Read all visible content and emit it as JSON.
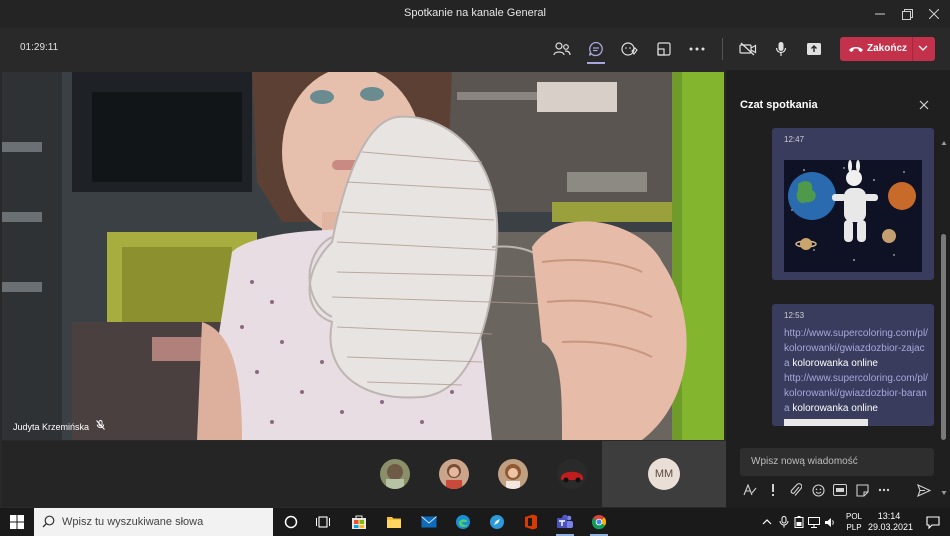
{
  "window": {
    "title": "Spotkanie na kanale General"
  },
  "toolbar": {
    "timer": "01:29:11",
    "end_label": "Zakończ"
  },
  "video": {
    "participant_name": "Judyta Krzemińska"
  },
  "participants": {
    "tile_initials": "MM"
  },
  "chat": {
    "title": "Czat spotkania",
    "messages": [
      {
        "time": "12:47"
      },
      {
        "time": "12:53",
        "link1": "http://www.supercoloring.com/pl/kolorowanki/gwiazdozbior-zajaca",
        "text1": " kolorowanka online",
        "link2": "http://www.supercoloring.com/pl/kolorowanki/gwiazdozbior-barana",
        "text2": " kolorowanka online"
      }
    ],
    "compose_placeholder": "Wpisz nową wiadomość"
  },
  "taskbar": {
    "search_placeholder": "Wpisz tu wyszukiwane słowa",
    "lang_top": "POL",
    "lang_bottom": "PLP",
    "time": "13:14",
    "date": "29.03.2021"
  },
  "colors": {
    "accent": "#a6a7dc",
    "end_call": "#c4314b",
    "chat_bubble": "#393c5d"
  }
}
